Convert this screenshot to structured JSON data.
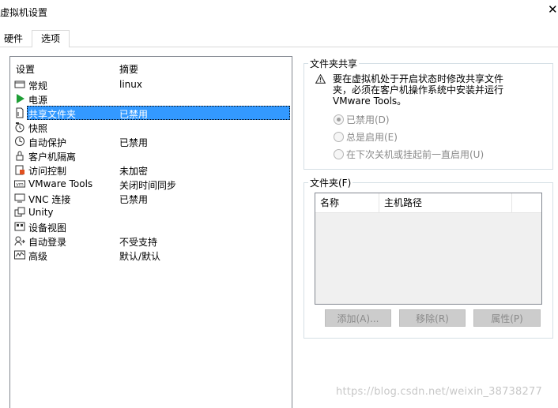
{
  "window": {
    "title": "虚拟机设置",
    "close_glyph": "✕"
  },
  "tabs": [
    {
      "label": "硬件"
    },
    {
      "label": "选项"
    }
  ],
  "list": {
    "columns": {
      "setting": "设置",
      "summary": "摘要"
    },
    "items": [
      {
        "icon": "general-icon",
        "name": "常规",
        "summary": "linux"
      },
      {
        "icon": "power-icon",
        "name": "电源",
        "summary": ""
      },
      {
        "icon": "shared-folder-icon",
        "name": "共享文件夹",
        "summary": "已禁用"
      },
      {
        "icon": "snapshot-icon",
        "name": "快照",
        "summary": ""
      },
      {
        "icon": "autoprotect-icon",
        "name": "自动保护",
        "summary": "已禁用"
      },
      {
        "icon": "lock-icon",
        "name": "客户机隔离",
        "summary": ""
      },
      {
        "icon": "access-control-icon",
        "name": "访问控制",
        "summary": "未加密"
      },
      {
        "icon": "vmware-tools-icon",
        "name": "VMware Tools",
        "summary": "关闭时间同步"
      },
      {
        "icon": "vnc-icon",
        "name": "VNC 连接",
        "summary": "已禁用"
      },
      {
        "icon": "unity-icon",
        "name": "Unity",
        "summary": ""
      },
      {
        "icon": "device-view-icon",
        "name": "设备视图",
        "summary": ""
      },
      {
        "icon": "autologin-icon",
        "name": "自动登录",
        "summary": "不受支持"
      },
      {
        "icon": "advanced-icon",
        "name": "高级",
        "summary": "默认/默认"
      }
    ],
    "selected_index": 2
  },
  "folder_sharing": {
    "title": "文件夹共享",
    "warning_icon": "warning-icon",
    "warning_lines": [
      "要在虚拟机处于开启状态时修改共享文件",
      "夹，必须在客户机操作系统中安装并运行",
      "VMware Tools。"
    ],
    "options": [
      {
        "label": "已禁用(D)",
        "checked": true
      },
      {
        "label": "总是启用(E)",
        "checked": false
      },
      {
        "label": "在下次关机或挂起前一直启用(U)",
        "checked": false
      }
    ]
  },
  "folders": {
    "title": "文件夹(F)",
    "columns": [
      "名称",
      "主机路径"
    ],
    "buttons": {
      "add": "添加(A)...",
      "remove": "移除(R)",
      "properties": "属性(P)"
    }
  },
  "watermark": "https://blog.csdn.net/weixin_38738277"
}
